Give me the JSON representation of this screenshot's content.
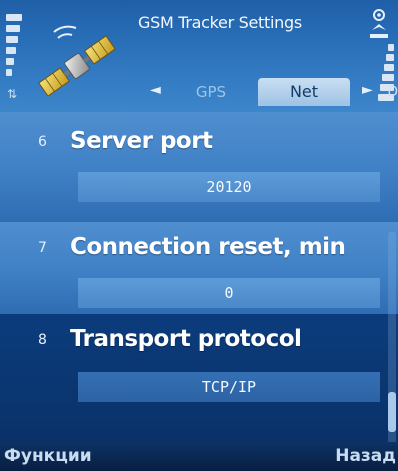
{
  "header": {
    "title": "GSM Tracker Settings",
    "tabs": [
      {
        "label": "GPS",
        "active": false
      },
      {
        "label": "Net",
        "active": true
      }
    ],
    "prev_arrow": "◄",
    "next_arrow": "►",
    "more_tab_hint": "D",
    "net_glyph": "⇅"
  },
  "settings": [
    {
      "number": "6",
      "label": "Server port",
      "value": "20120",
      "highlighted": true
    },
    {
      "number": "7",
      "label": "Connection reset, min",
      "value": "0",
      "highlighted": true
    },
    {
      "number": "8",
      "label": "Transport protocol",
      "value": "TCP/IP",
      "highlighted": false
    }
  ],
  "softkeys": {
    "left": "Функции",
    "right": "Назад"
  },
  "colors": {
    "accent": "#3f7fc4",
    "header": "#2b72bb",
    "background": "#0d3d7c",
    "text": "#ffffff"
  },
  "icons": {
    "app_logo": "satellite-icon",
    "signal": "signal-strength-icon",
    "battery": "battery-level-icon",
    "notification": "gps-indicator-icon"
  }
}
